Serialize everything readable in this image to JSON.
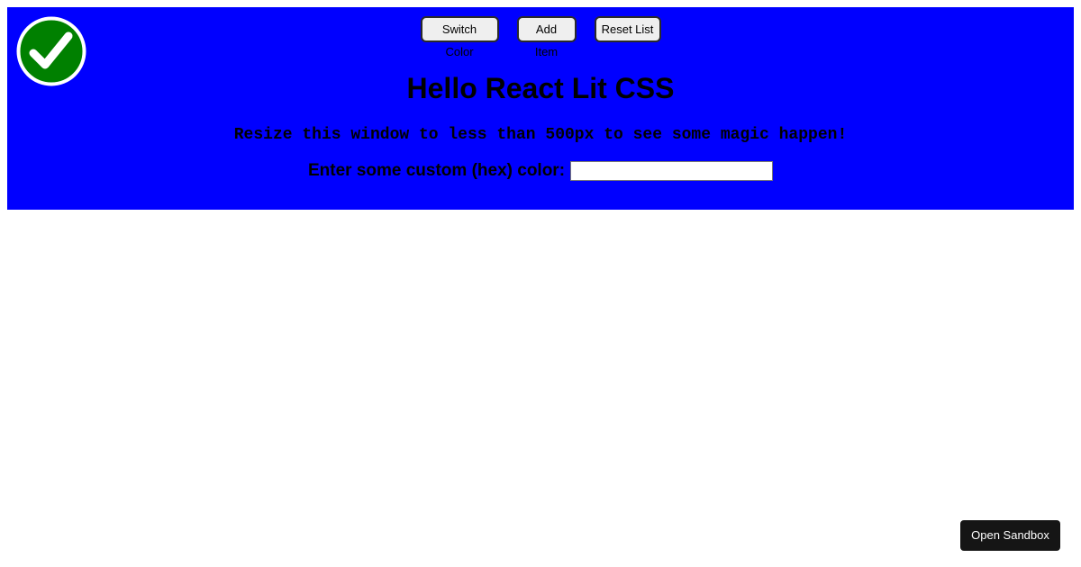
{
  "toolbar": {
    "switch_color_label": "Switch Color",
    "add_item_label": "Add Item",
    "reset_list_label": "Reset List"
  },
  "main": {
    "title": "Hello React Lit CSS",
    "hint": "Resize this window to less than 500px to see some magic happen!",
    "color_label": "Enter some custom (hex) color:",
    "color_value": "",
    "color_placeholder": ""
  },
  "footer": {
    "open_sandbox_label": "Open Sandbox"
  },
  "icons": {
    "badge": "checkmark-icon"
  },
  "colors": {
    "panel_background": "#0000ff",
    "badge_fill": "#008000",
    "badge_border": "#ffffff",
    "sandbox_button": "#151515"
  }
}
